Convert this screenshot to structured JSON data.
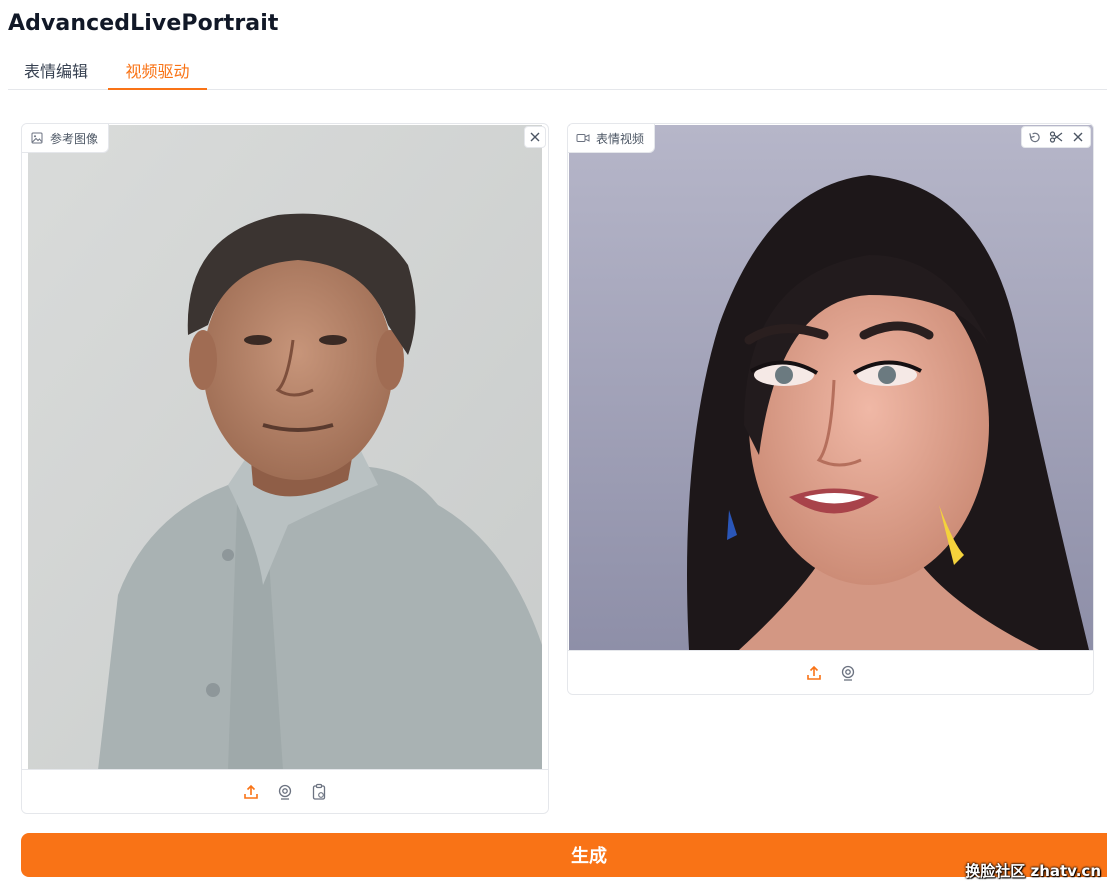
{
  "app": {
    "title": "AdvancedLivePortrait"
  },
  "tabs": [
    {
      "label": "表情编辑",
      "active": false
    },
    {
      "label": "视频驱动",
      "active": true
    }
  ],
  "reference_panel": {
    "label": "参考图像",
    "icon": "image-icon"
  },
  "expression_panel": {
    "label": "表情视频",
    "icon": "video-icon"
  },
  "generate_button": {
    "label": "生成"
  },
  "watermark": {
    "text": "换脸社区 zhatv.cn"
  },
  "colors": {
    "accent": "#f97316",
    "border": "#e5e7eb"
  }
}
